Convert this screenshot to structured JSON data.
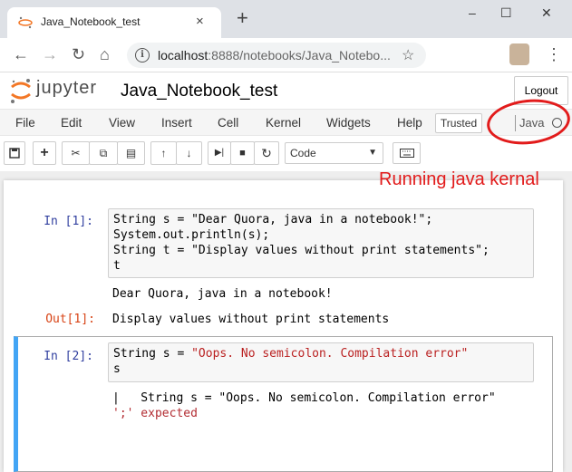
{
  "browser": {
    "tab_title": "Java_Notebook_test",
    "tab_close": "×",
    "new_tab": "+",
    "address": {
      "host": "localhost",
      "path": ":8888/notebooks/Java_Notebo..."
    },
    "controls": {
      "minimize": "–",
      "maximize": "☐",
      "close": "✕"
    },
    "nav": {
      "back": "←",
      "forward": "→",
      "reload": "↻",
      "home": "⌂",
      "star": "☆",
      "menu": "⋮"
    }
  },
  "jupyter": {
    "logo_text": "jupyter",
    "notebook_name": "Java_Notebook_test",
    "logout": "Logout",
    "menus": [
      "File",
      "Edit",
      "View",
      "Insert",
      "Cell",
      "Kernel",
      "Widgets",
      "Help"
    ],
    "trusted": "Trusted",
    "kernel": "Java",
    "cell_type": "Code"
  },
  "annotation": {
    "text": "Running java kernal",
    "color": "#e21b1b"
  },
  "cells": [
    {
      "prompt": "In [1]:",
      "code": [
        "String s = \"Dear Quora, java in a notebook!\";",
        "System.out.println(s);",
        "String t = \"Display values without print statements\";",
        "t"
      ],
      "stdout": "Dear Quora, java in a notebook!",
      "out_prompt": "Out[1]:",
      "result": "Display values without print statements"
    },
    {
      "prompt": "In [2]:",
      "code_prefix": "String s = ",
      "code_string": "\"Oops. No semicolon. Compilation error\"",
      "code_line2": "s",
      "error_line1": "|   String s = \"Oops. No semicolon. Compilation error\"",
      "error_line2_str": "';'",
      "error_line2_rest": " expected"
    }
  ],
  "colors": {
    "prompt_in": "#303f9f",
    "prompt_out": "#d84315",
    "selected_cell_border": "#42a5f5"
  }
}
